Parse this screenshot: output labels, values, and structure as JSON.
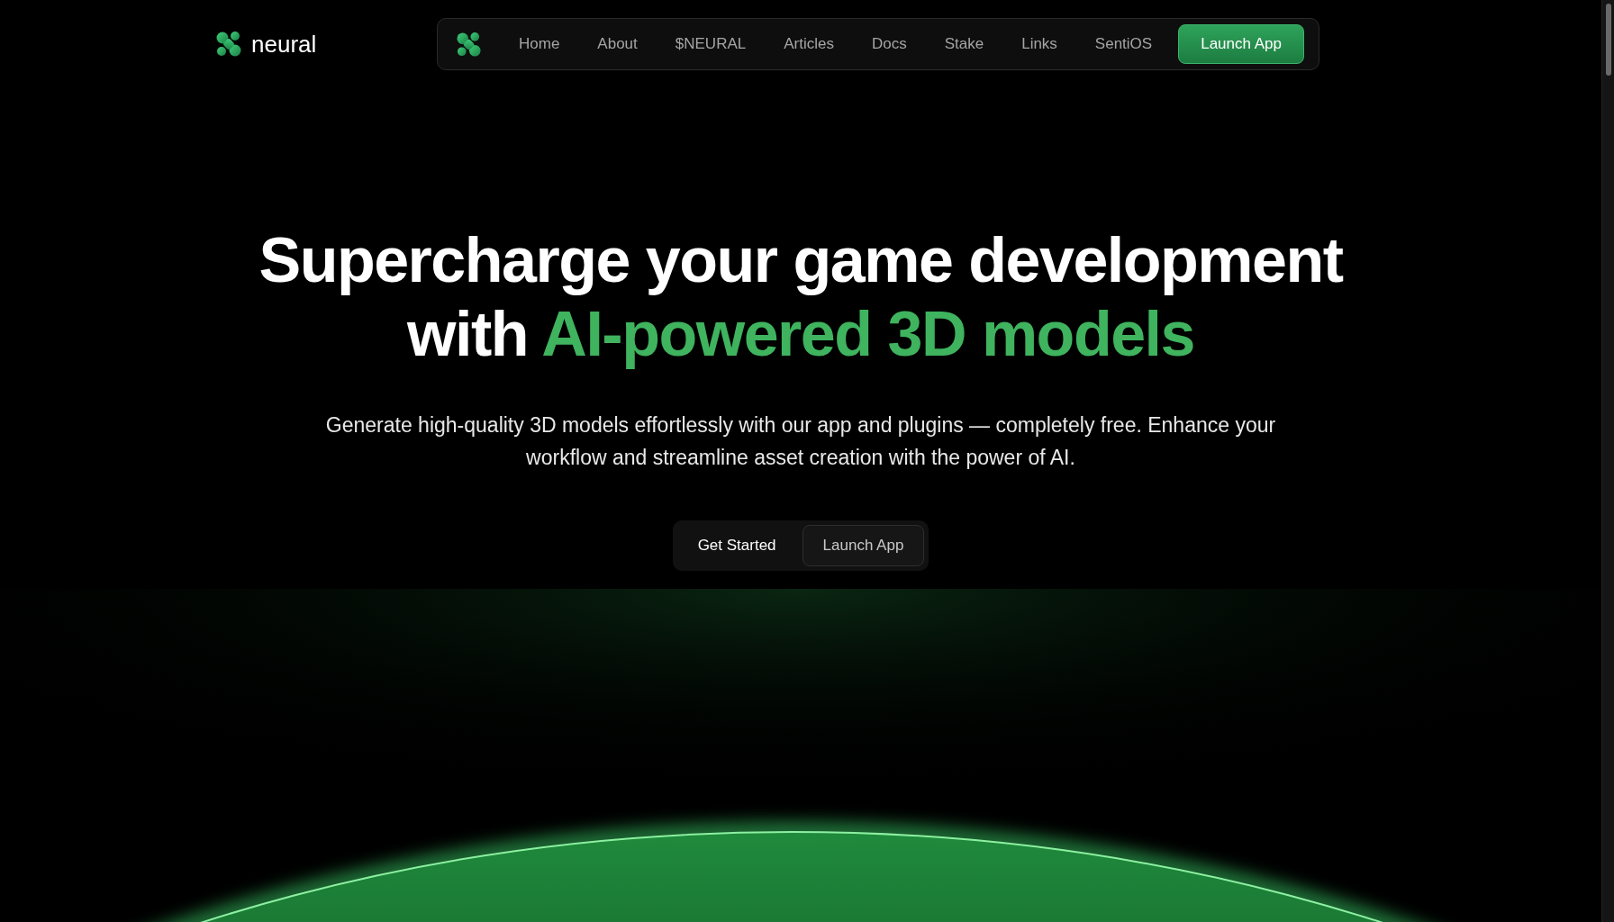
{
  "brand": {
    "name": "neural"
  },
  "nav": {
    "items": [
      "Home",
      "About",
      "$NEURAL",
      "Articles",
      "Docs",
      "Stake",
      "Links",
      "SentiOS"
    ],
    "cta": "Launch App"
  },
  "hero": {
    "headline": "Supercharge your game development with",
    "highlight": "AI-powered 3D models",
    "subtitle": "Generate high-quality 3D models effortlessly with our app and plugins — completely free. Enhance your workflow and streamline asset creation with the power of AI.",
    "buttons": [
      {
        "label": "Get Started",
        "kind": "plain"
      },
      {
        "label": "Launch App",
        "kind": "outlined"
      }
    ]
  }
}
